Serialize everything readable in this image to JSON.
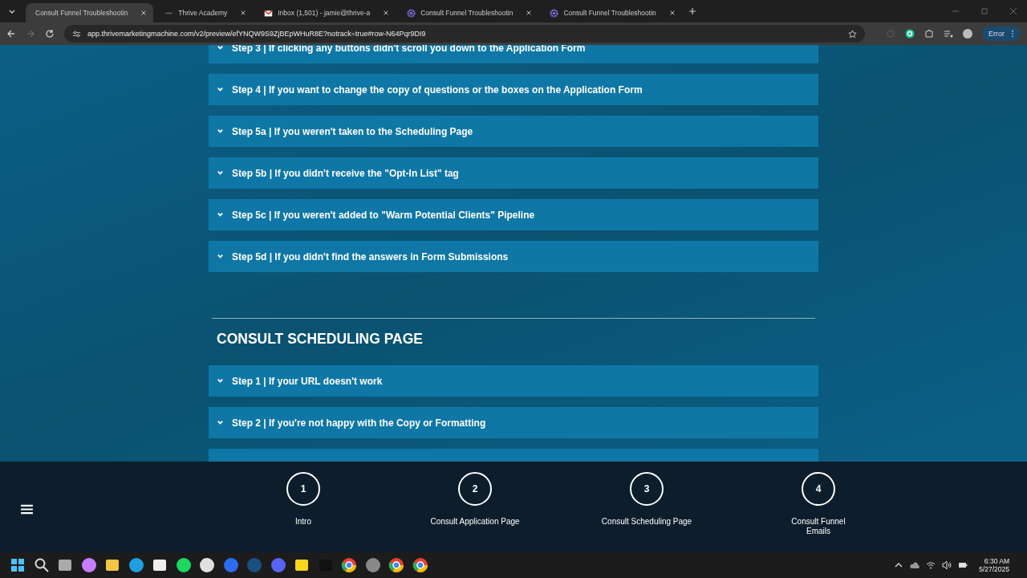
{
  "browser": {
    "tabs": [
      {
        "title": "Consult Funnel Troubleshootin",
        "selected": true,
        "kind": "blank"
      },
      {
        "title": "Thrive Academy",
        "selected": false,
        "kind": "dash"
      },
      {
        "title": "Inbox (1,501) - jamie@thrive-a",
        "selected": false,
        "kind": "mail"
      },
      {
        "title": "Consult Funnel Troubleshootin",
        "selected": false,
        "kind": "gear"
      },
      {
        "title": "Consult Funnel Troubleshootin",
        "selected": false,
        "kind": "gear"
      }
    ],
    "url": "app.thrivemarketingmachine.com/v2/preview/efYNQW9S9ZjBEpWHuR8E?notrack=true#row-N64Pqr9DI9",
    "profile_button": "Error"
  },
  "sections": [
    {
      "steps": [
        {
          "label": "Step 3 | If clicking any buttons didn't scroll you down to the Application Form",
          "expanded": false
        },
        {
          "label": "Step 4 | If you want to change the copy of questions or the boxes on the Application Form",
          "expanded": false
        },
        {
          "label": "Step 5a | If you weren't taken to the Scheduling Page",
          "expanded": false
        },
        {
          "label": "Step 5b | If you didn't receive the \"Opt-In List\" tag",
          "expanded": false
        },
        {
          "label": "Step 5c | If you weren't added to \"Warm Potential Clients\" Pipeline",
          "expanded": false
        },
        {
          "label": "Step 5d | If you didn't find the answers in Form Submissions",
          "expanded": false
        }
      ]
    },
    {
      "heading": "CONSULT SCHEDULING PAGE",
      "steps": [
        {
          "label": "Step 1 | If your URL doesn't work",
          "expanded": false
        },
        {
          "label": "Step 2 | If you're not happy with the Copy or Formatting",
          "expanded": false
        }
      ]
    }
  ],
  "nav": [
    {
      "number": "1",
      "label": "Intro"
    },
    {
      "number": "2",
      "label": "Consult Application Page"
    },
    {
      "number": "3",
      "label": "Consult Scheduling Page"
    },
    {
      "number": "4",
      "label": "Consult Funnel Emails"
    }
  ],
  "taskbar": {
    "time": "6:30 AM",
    "date": "5/27/2025"
  }
}
